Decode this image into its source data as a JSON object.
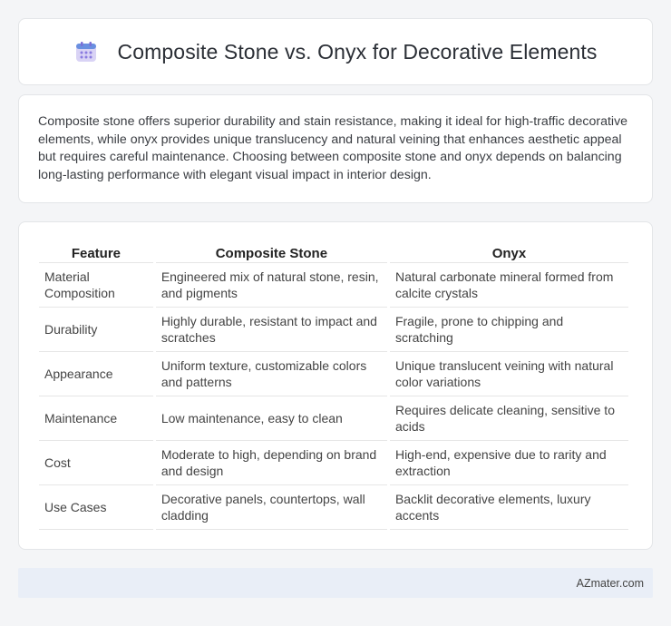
{
  "header": {
    "title": "Composite Stone vs. Onyx for Decorative Elements",
    "icon": "calendar-icon"
  },
  "summary": {
    "text": "Composite stone offers superior durability and stain resistance, making it ideal for high-traffic decorative elements, while onyx provides unique translucency and natural veining that enhances aesthetic appeal but requires careful maintenance. Choosing between composite stone and onyx depends on balancing long-lasting performance with elegant visual impact in interior design."
  },
  "table": {
    "headers": [
      "Feature",
      "Composite Stone",
      "Onyx"
    ],
    "rows": [
      [
        "Material Composition",
        "Engineered mix of natural stone, resin, and pigments",
        "Natural carbonate mineral formed from calcite crystals"
      ],
      [
        "Durability",
        "Highly durable, resistant to impact and scratches",
        "Fragile, prone to chipping and scratching"
      ],
      [
        "Appearance",
        "Uniform texture, customizable colors and patterns",
        "Unique translucent veining with natural color variations"
      ],
      [
        "Maintenance",
        "Low maintenance, easy to clean",
        "Requires delicate cleaning, sensitive to acids"
      ],
      [
        "Cost",
        "Moderate to high, depending on brand and design",
        "High-end, expensive due to rarity and extraction"
      ],
      [
        "Use Cases",
        "Decorative panels, countertops, wall cladding",
        "Backlit decorative elements, luxury accents"
      ]
    ]
  },
  "footer": {
    "brand": "AZmater.com"
  },
  "colors": {
    "accent": "#7b6fd6",
    "footer_bg": "#e9eef7"
  }
}
